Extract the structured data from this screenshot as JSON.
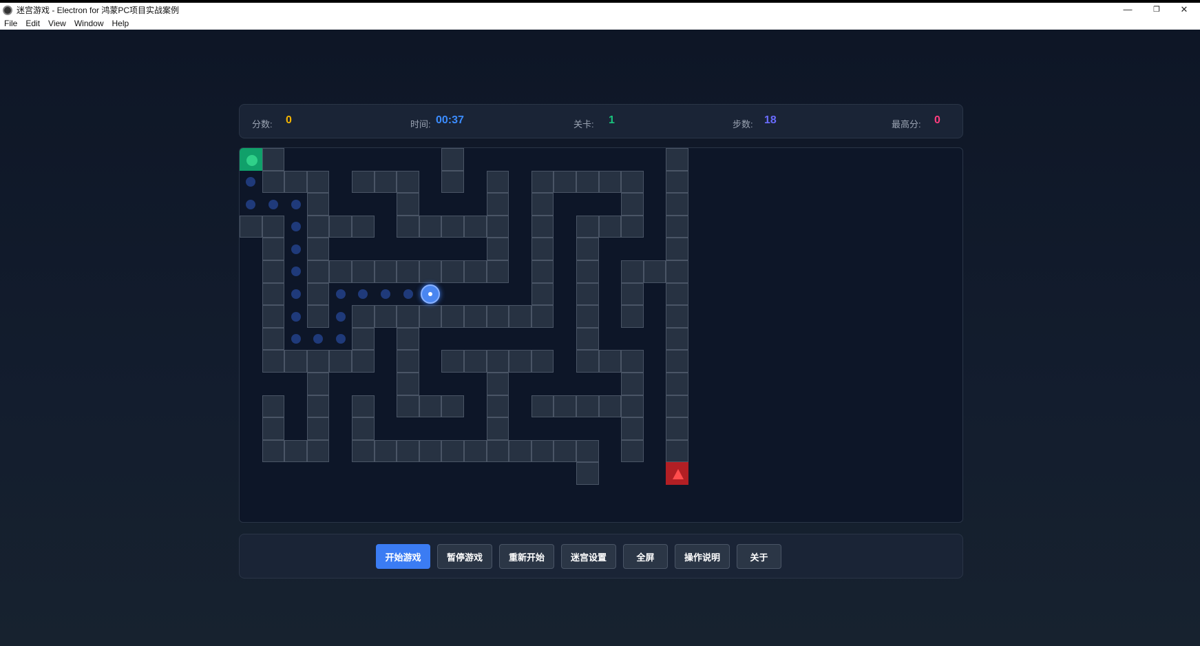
{
  "window": {
    "title": "迷宫游戏 - Electron for 鸿蒙PC项目实战案例",
    "min": "—",
    "max": "❐",
    "close": "✕"
  },
  "menu": [
    "File",
    "Edit",
    "View",
    "Window",
    "Help"
  ],
  "stats": {
    "score": {
      "label": "分数:",
      "value": "0",
      "color": "#f4b400"
    },
    "time": {
      "label": "时间:",
      "value": "00:37",
      "color": "#3b8cff"
    },
    "level": {
      "label": "关卡:",
      "value": "1",
      "color": "#19c37d"
    },
    "steps": {
      "label": "步数:",
      "value": "18",
      "color": "#6a6cff"
    },
    "best": {
      "label": "最高分:",
      "value": "0",
      "color": "#ff3d7f"
    }
  },
  "maze": {
    "rows": 15,
    "cols": 20,
    "walls": [
      "0,1",
      "0,9",
      "0,19",
      "1,1",
      "1,2",
      "1,3",
      "1,5",
      "1,6",
      "1,7",
      "1,9",
      "1,11",
      "1,13",
      "1,14",
      "1,15",
      "1,16",
      "1,17",
      "1,19",
      "2,3",
      "2,7",
      "2,11",
      "2,13",
      "2,17",
      "2,19",
      "3,0",
      "3,1",
      "3,3",
      "3,4",
      "3,5",
      "3,7",
      "3,8",
      "3,9",
      "3,10",
      "3,11",
      "3,13",
      "3,15",
      "3,16",
      "3,17",
      "3,19",
      "4,1",
      "4,3",
      "4,11",
      "4,13",
      "4,15",
      "4,19",
      "5,1",
      "5,3",
      "5,4",
      "5,5",
      "5,6",
      "5,7",
      "5,8",
      "5,9",
      "5,10",
      "5,11",
      "5,13",
      "5,15",
      "5,17",
      "5,18",
      "5,19",
      "6,1",
      "6,3",
      "6,13",
      "6,15",
      "6,17",
      "6,19",
      "7,1",
      "7,3",
      "7,5",
      "7,6",
      "7,7",
      "7,8",
      "7,9",
      "7,10",
      "7,11",
      "7,12",
      "7,13",
      "7,15",
      "7,17",
      "7,19",
      "8,1",
      "8,5",
      "8,7",
      "8,15",
      "8,19",
      "9,1",
      "9,2",
      "9,3",
      "9,4",
      "9,5",
      "9,7",
      "9,9",
      "9,10",
      "9,11",
      "9,12",
      "9,13",
      "9,15",
      "9,16",
      "9,17",
      "9,19",
      "10,3",
      "10,7",
      "10,11",
      "10,17",
      "10,19",
      "11,1",
      "11,3",
      "11,5",
      "11,7",
      "11,8",
      "11,9",
      "11,11",
      "11,13",
      "11,14",
      "11,15",
      "11,16",
      "11,17",
      "11,19",
      "12,1",
      "12,3",
      "12,5",
      "12,11",
      "12,17",
      "12,19",
      "13,1",
      "13,2",
      "13,3",
      "13,5",
      "13,6",
      "13,7",
      "13,8",
      "13,9",
      "13,10",
      "13,11",
      "13,12",
      "13,13",
      "13,14",
      "13,15",
      "13,17",
      "13,19",
      "14,15"
    ],
    "trail": [
      "1,0",
      "2,0",
      "2,1",
      "2,2",
      "3,2",
      "4,2",
      "5,2",
      "6,2",
      "7,2",
      "8,2",
      "8,3",
      "8,4",
      "7,4",
      "6,4",
      "6,5",
      "6,6",
      "6,7"
    ],
    "player": "6,8",
    "start": "0,0",
    "end": "14,19"
  },
  "buttons": [
    {
      "label": "开始游戏",
      "primary": true
    },
    {
      "label": "暂停游戏"
    },
    {
      "label": "重新开始"
    },
    {
      "label": "迷宫设置"
    },
    {
      "label": "全屏"
    },
    {
      "label": "操作说明"
    },
    {
      "label": "关于"
    }
  ]
}
